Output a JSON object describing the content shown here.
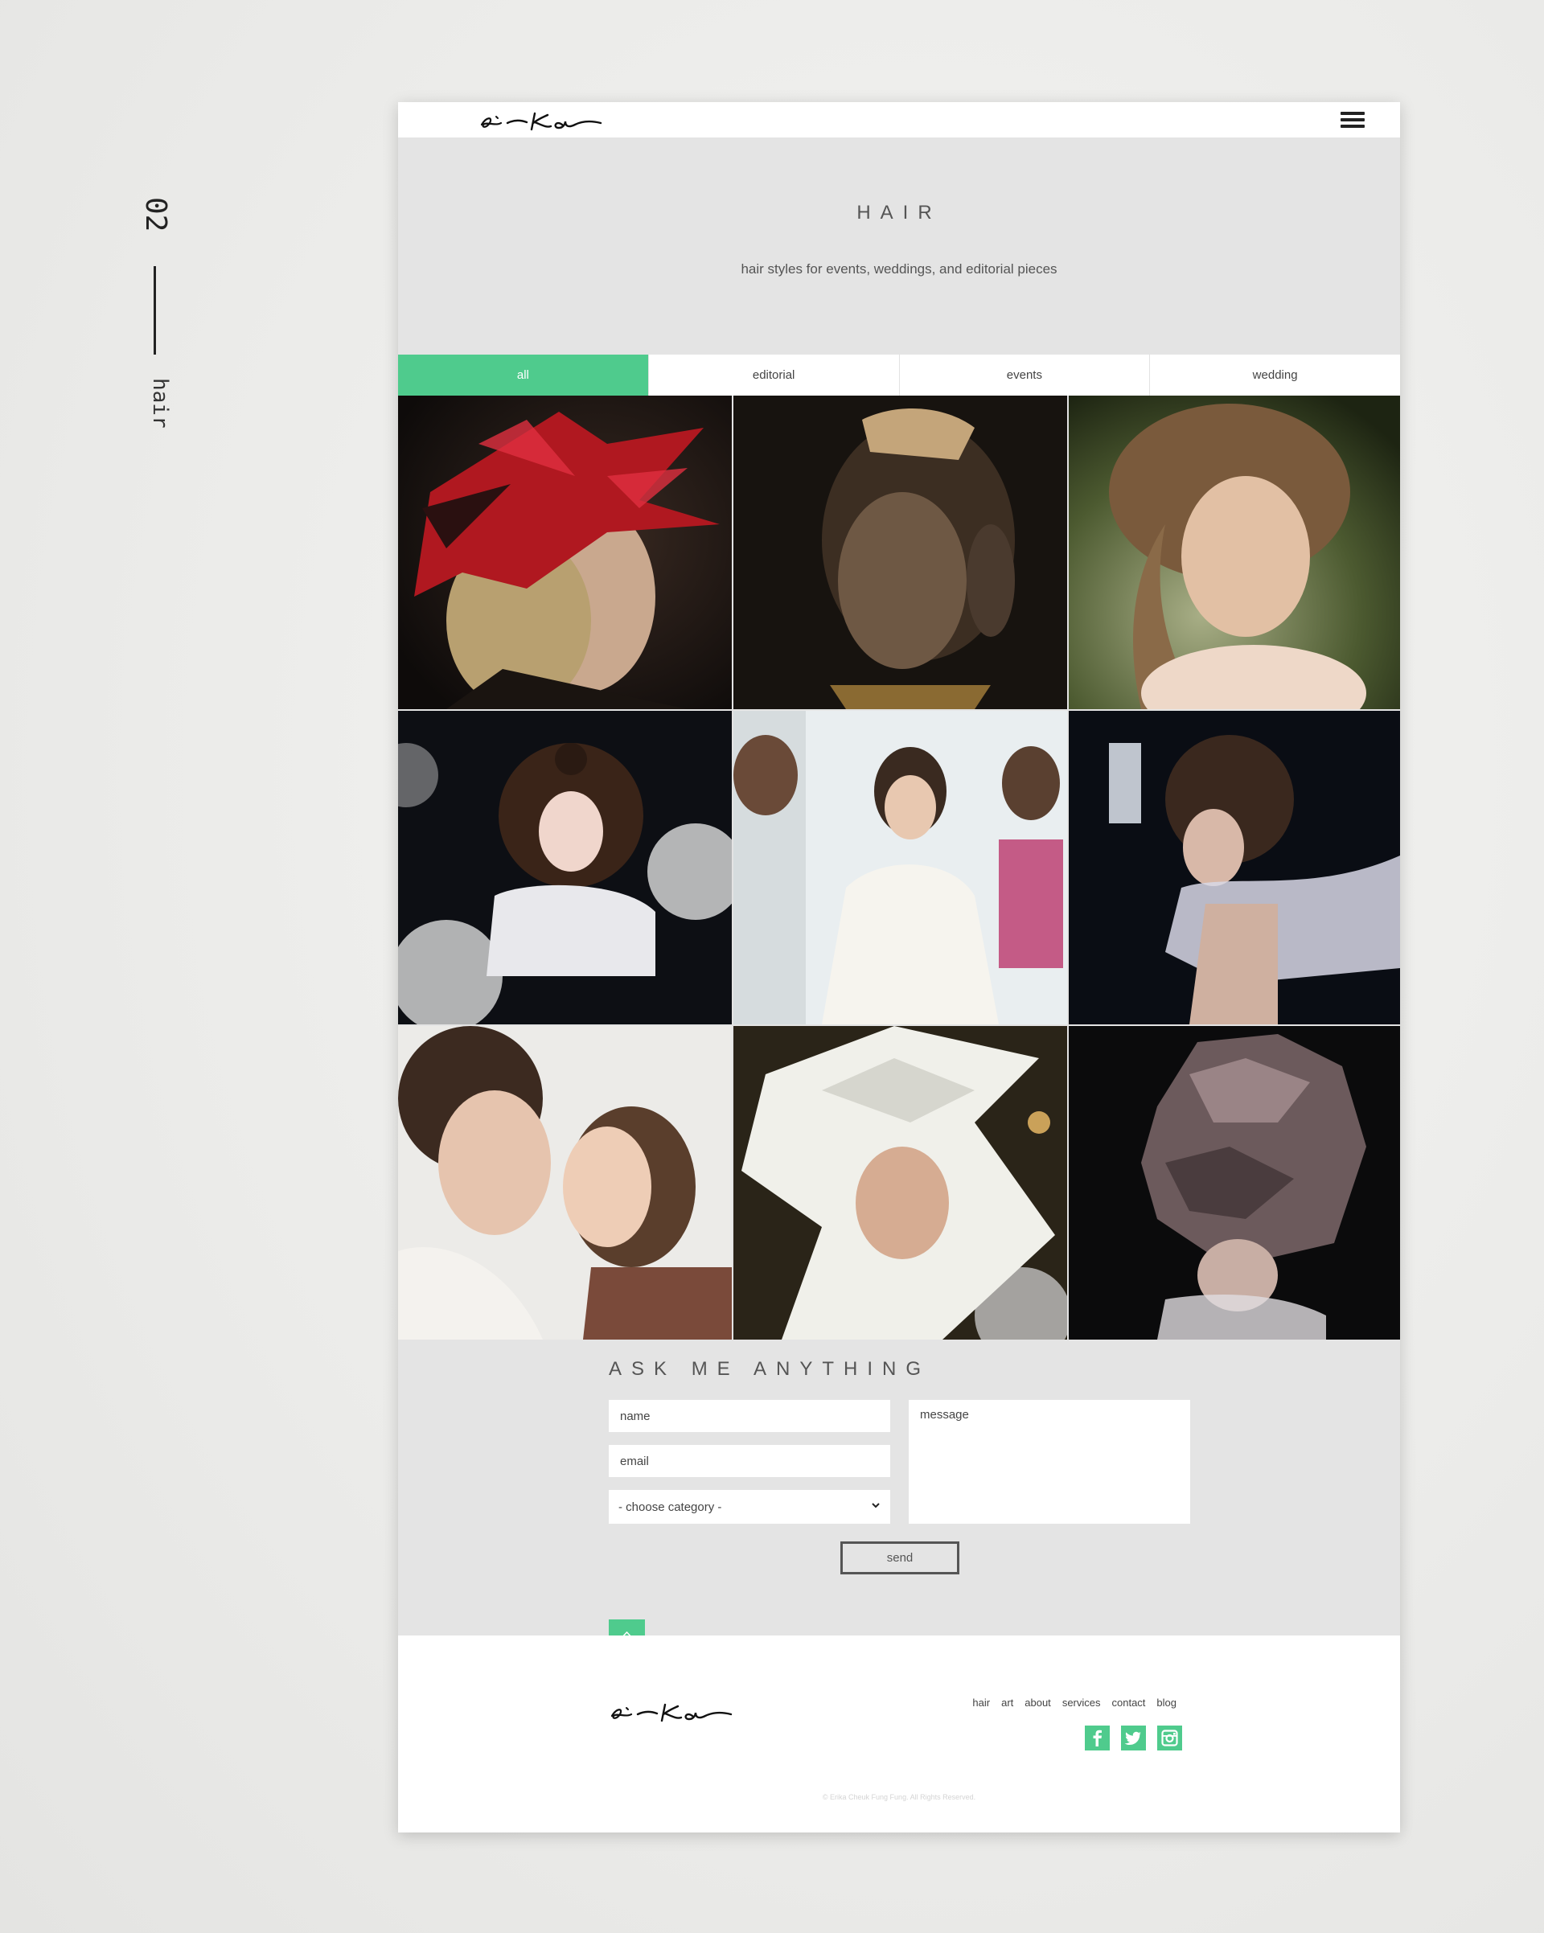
{
  "side": {
    "number": "02",
    "word": "hair"
  },
  "header": {
    "logo_text": "e-ka",
    "menu_icon": "hamburger-icon"
  },
  "hero": {
    "title": "HAIR",
    "subtitle": "hair styles for events, weddings, and editorial pieces"
  },
  "tabs": [
    {
      "label": "all",
      "active": true
    },
    {
      "label": "editorial",
      "active": false
    },
    {
      "label": "events",
      "active": false
    },
    {
      "label": "wedding",
      "active": false
    }
  ],
  "gallery": [
    {
      "subject": "red feather headpiece editorial"
    },
    {
      "subject": "braided hair dark portrait"
    },
    {
      "subject": "brunette updo backlit portrait"
    },
    {
      "subject": "avant-garde hair with lanterns"
    },
    {
      "subject": "bride getting ready"
    },
    {
      "subject": "curly updo with tulle"
    },
    {
      "subject": "bride and girl smiling"
    },
    {
      "subject": "white feather headpiece"
    },
    {
      "subject": "sculptural lantern headpiece"
    }
  ],
  "contact": {
    "title": "ASK ME ANYTHING",
    "name_placeholder": "name",
    "email_placeholder": "email",
    "category_selected": "- choose category -",
    "message_placeholder": "message",
    "send_label": "send"
  },
  "footer": {
    "logo_text": "e-ka",
    "nav": [
      "hair",
      "art",
      "about",
      "services",
      "contact",
      "blog"
    ],
    "socials": [
      "facebook-icon",
      "twitter-icon",
      "instagram-icon"
    ],
    "copyright": "© Erika Cheuk Fung Fung. All Rights Reserved."
  },
  "colors": {
    "accent": "#4fcb8d",
    "page_bg": "#e4e4e4",
    "text": "#555555"
  }
}
